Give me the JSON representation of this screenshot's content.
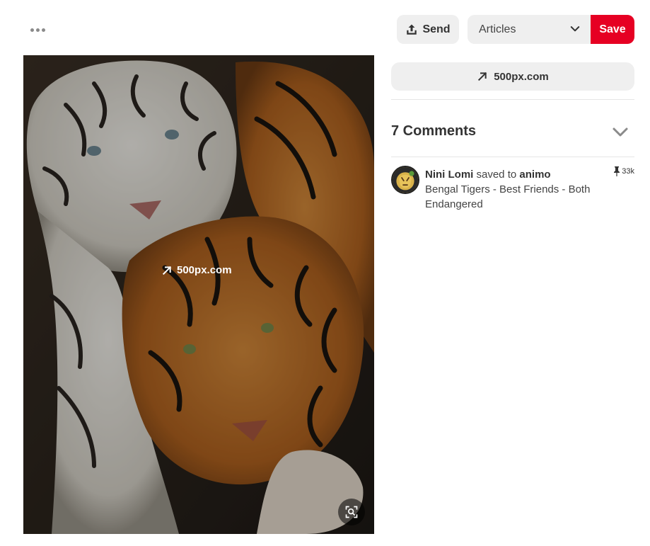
{
  "toolbar": {
    "more_label": "More options",
    "send_label": "Send",
    "board_select_value": "Articles",
    "save_label": "Save"
  },
  "pin": {
    "image_alt": "Bengal Tigers - Best Friends - Both Endangered",
    "overlay_link": "500px.com"
  },
  "source": {
    "label": "500px.com"
  },
  "comments": {
    "heading": "7 Comments"
  },
  "activity": {
    "user": "Nini Lomi",
    "action": "saved to",
    "board": "animo",
    "description": "Bengal Tigers - Best Friends - Both Endangered",
    "saves": "33k"
  },
  "icons": {
    "more": "ellipsis-icon",
    "send": "share-upload-icon",
    "board_dropdown": "chevron-down-icon",
    "link": "arrow-up-right-icon",
    "lens": "visual-search-icon",
    "comments_toggle": "chevron-down-icon",
    "pin": "pushpin-icon"
  },
  "colors": {
    "save_red": "#e60023",
    "button_gray": "#efefef"
  }
}
